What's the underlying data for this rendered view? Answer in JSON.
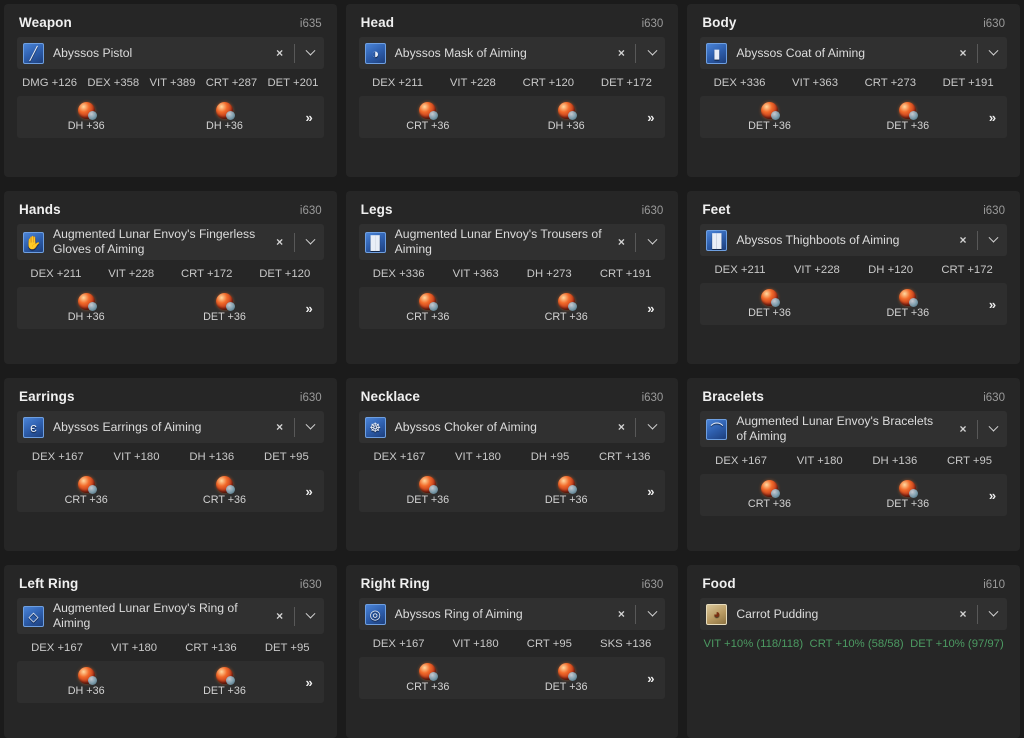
{
  "ui": {
    "clear_label": "×",
    "expand_label": "»",
    "dropdown_icon": "chevron-down-icon"
  },
  "colors": {
    "page_bg": "#1b1b1b",
    "card_bg": "#262626",
    "row_bg": "#303030",
    "materia_bg": "#2e2e2e",
    "text": "#e6e6e6",
    "ilvl_text": "#9a9a9a",
    "food_stat": "#4c9a62",
    "icon_blue": "#2e5fae"
  },
  "slots": [
    {
      "slot": "Weapon",
      "ilvl": "i635",
      "item": "Abyssos Pistol",
      "icon": "weapon-icon",
      "icon_glyph": "╱",
      "icon_kind": "gear",
      "stats": [
        "DMG +126",
        "DEX +358",
        "VIT +389",
        "CRT +287",
        "DET +201"
      ],
      "materia": [
        "DH +36",
        "DH +36"
      ],
      "has_materia": true
    },
    {
      "slot": "Head",
      "ilvl": "i630",
      "item": "Abyssos Mask of Aiming",
      "icon": "head-icon",
      "icon_glyph": "◑",
      "icon_kind": "gear",
      "stats": [
        "DEX +211",
        "VIT +228",
        "CRT +120",
        "DET +172"
      ],
      "materia": [
        "CRT +36",
        "DH +36"
      ],
      "has_materia": true
    },
    {
      "slot": "Body",
      "ilvl": "i630",
      "item": "Abyssos Coat of Aiming",
      "icon": "body-icon",
      "icon_glyph": "▮",
      "icon_kind": "gear",
      "stats": [
        "DEX +336",
        "VIT +363",
        "CRT +273",
        "DET +191"
      ],
      "materia": [
        "DET +36",
        "DET +36"
      ],
      "has_materia": true
    },
    {
      "slot": "Hands",
      "ilvl": "i630",
      "item": "Augmented Lunar Envoy's Fingerless Gloves of Aiming",
      "icon": "hands-icon",
      "icon_glyph": "✋",
      "icon_kind": "gear",
      "stats": [
        "DEX +211",
        "VIT +228",
        "CRT +172",
        "DET +120"
      ],
      "materia": [
        "DH +36",
        "DET +36"
      ],
      "has_materia": true
    },
    {
      "slot": "Legs",
      "ilvl": "i630",
      "item": "Augmented Lunar Envoy's Trousers of Aiming",
      "icon": "legs-icon",
      "icon_glyph": "▐▌",
      "icon_kind": "gear",
      "stats": [
        "DEX +336",
        "VIT +363",
        "DH +273",
        "CRT +191"
      ],
      "materia": [
        "CRT +36",
        "CRT +36"
      ],
      "has_materia": true
    },
    {
      "slot": "Feet",
      "ilvl": "i630",
      "item": "Abyssos Thighboots of Aiming",
      "icon": "feet-icon",
      "icon_glyph": "▐▌",
      "icon_kind": "gear",
      "stats": [
        "DEX +211",
        "VIT +228",
        "DH +120",
        "CRT +172"
      ],
      "materia": [
        "DET +36",
        "DET +36"
      ],
      "has_materia": true
    },
    {
      "slot": "Earrings",
      "ilvl": "i630",
      "item": "Abyssos Earrings of Aiming",
      "icon": "earrings-icon",
      "icon_glyph": "є",
      "icon_kind": "gear",
      "stats": [
        "DEX +167",
        "VIT +180",
        "DH +136",
        "DET +95"
      ],
      "materia": [
        "CRT +36",
        "CRT +36"
      ],
      "has_materia": true
    },
    {
      "slot": "Necklace",
      "ilvl": "i630",
      "item": "Abyssos Choker of Aiming",
      "icon": "necklace-icon",
      "icon_glyph": "☸",
      "icon_kind": "gear",
      "stats": [
        "DEX +167",
        "VIT +180",
        "DH +95",
        "CRT +136"
      ],
      "materia": [
        "DET +36",
        "DET +36"
      ],
      "has_materia": true
    },
    {
      "slot": "Bracelets",
      "ilvl": "i630",
      "item": "Augmented Lunar Envoy's Bracelets of Aiming",
      "icon": "bracelets-icon",
      "icon_glyph": "⌒",
      "icon_kind": "gear",
      "stats": [
        "DEX +167",
        "VIT +180",
        "DH +136",
        "CRT +95"
      ],
      "materia": [
        "CRT +36",
        "DET +36"
      ],
      "has_materia": true
    },
    {
      "slot": "Left Ring",
      "ilvl": "i630",
      "item": "Augmented Lunar Envoy's Ring of Aiming",
      "icon": "left-ring-icon",
      "icon_glyph": "◇",
      "icon_kind": "gear",
      "stats": [
        "DEX +167",
        "VIT +180",
        "CRT +136",
        "DET +95"
      ],
      "materia": [
        "DH +36",
        "DET +36"
      ],
      "has_materia": true
    },
    {
      "slot": "Right Ring",
      "ilvl": "i630",
      "item": "Abyssos Ring of Aiming",
      "icon": "right-ring-icon",
      "icon_glyph": "◎",
      "icon_kind": "gear",
      "stats": [
        "DEX +167",
        "VIT +180",
        "CRT +95",
        "SKS +136"
      ],
      "materia": [
        "CRT +36",
        "DET +36"
      ],
      "has_materia": true
    },
    {
      "slot": "Food",
      "ilvl": "i610",
      "item": "Carrot Pudding",
      "icon": "food-icon",
      "icon_glyph": "◕",
      "icon_kind": "food",
      "stats": [
        "VIT +10% (118/118)",
        "CRT +10% (58/58)",
        "DET +10% (97/97)"
      ],
      "materia": [],
      "has_materia": false
    }
  ]
}
